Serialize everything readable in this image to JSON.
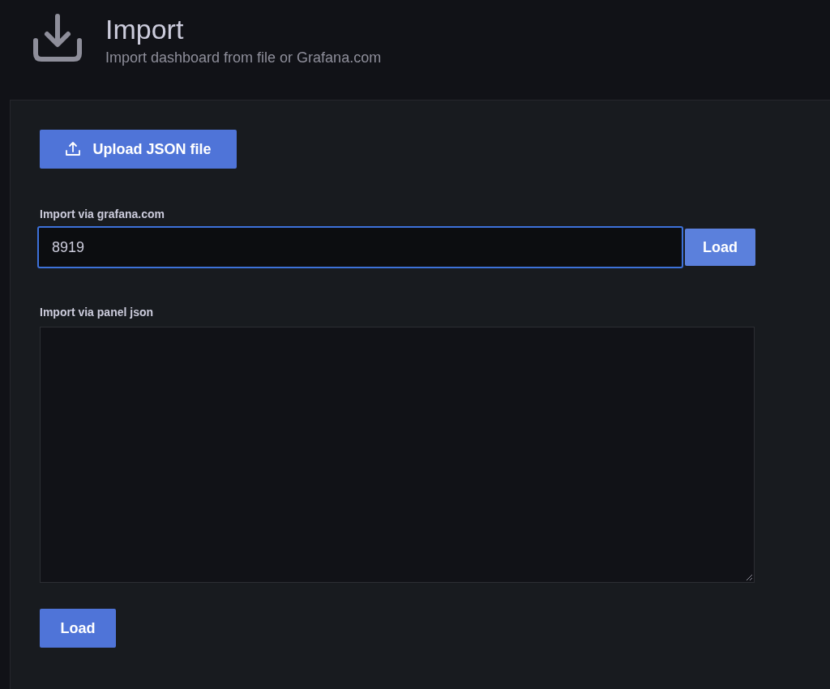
{
  "header": {
    "title": "Import",
    "subtitle": "Import dashboard from file or Grafana.com"
  },
  "upload_button": {
    "label": "Upload JSON file"
  },
  "grafana_import": {
    "label": "Import via grafana.com",
    "value": "8919",
    "focused": true,
    "button": "Load"
  },
  "panel_json_import": {
    "label": "Import via panel json",
    "button": "Load"
  }
}
